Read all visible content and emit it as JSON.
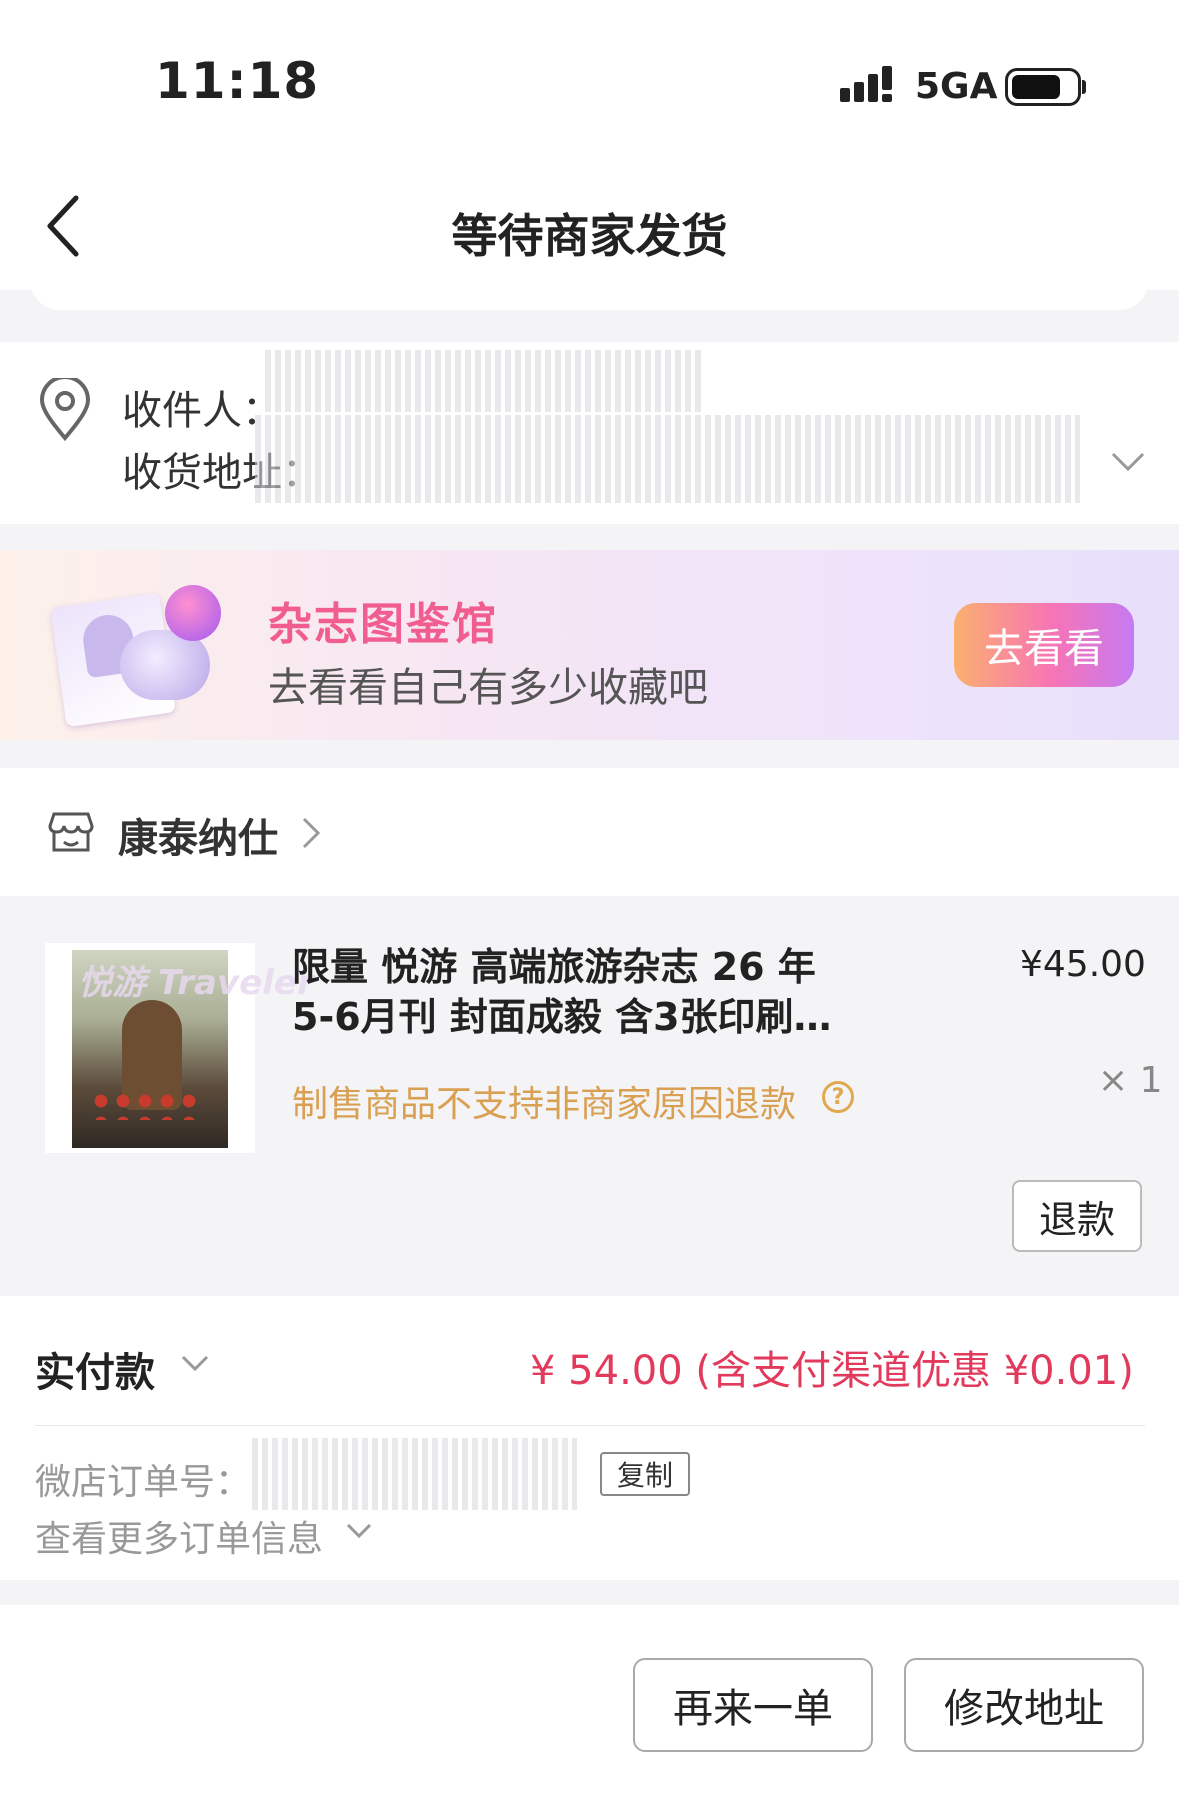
{
  "status_bar": {
    "time": "11:18",
    "network": "5GA"
  },
  "header": {
    "title": "等待商家发货"
  },
  "address": {
    "recipient_label": "收件人：",
    "address_label": "收货地址："
  },
  "banner": {
    "title": "杂志图鉴馆",
    "subtitle": "去看看自己有多少收藏吧",
    "button": "去看看"
  },
  "store": {
    "name": "康泰纳仕"
  },
  "product": {
    "name_line1": "限量 悦游 高端旅游杂志 26 年",
    "name_line2": "5-6月刊 封面成毅 含3张印刷…",
    "cover_text": "悦游 Traveler",
    "price": "¥45.00",
    "quantity": "× 1",
    "notice": "制售商品不支持非商家原因退款",
    "help_icon": "?",
    "refund_button": "退款"
  },
  "payment": {
    "label": "实付款",
    "amount": "¥ 54.00 (含支付渠道优惠 ¥0.01)",
    "order_label": "微店订单号：",
    "copy_button": "复制",
    "more_info": "查看更多订单信息"
  },
  "footer": {
    "reorder_button": "再来一单",
    "change_address_button": "修改地址"
  },
  "colors": {
    "price_red": "#e23a5c",
    "notice_orange": "#d9a053",
    "banner_pink": "#f05d8e"
  }
}
